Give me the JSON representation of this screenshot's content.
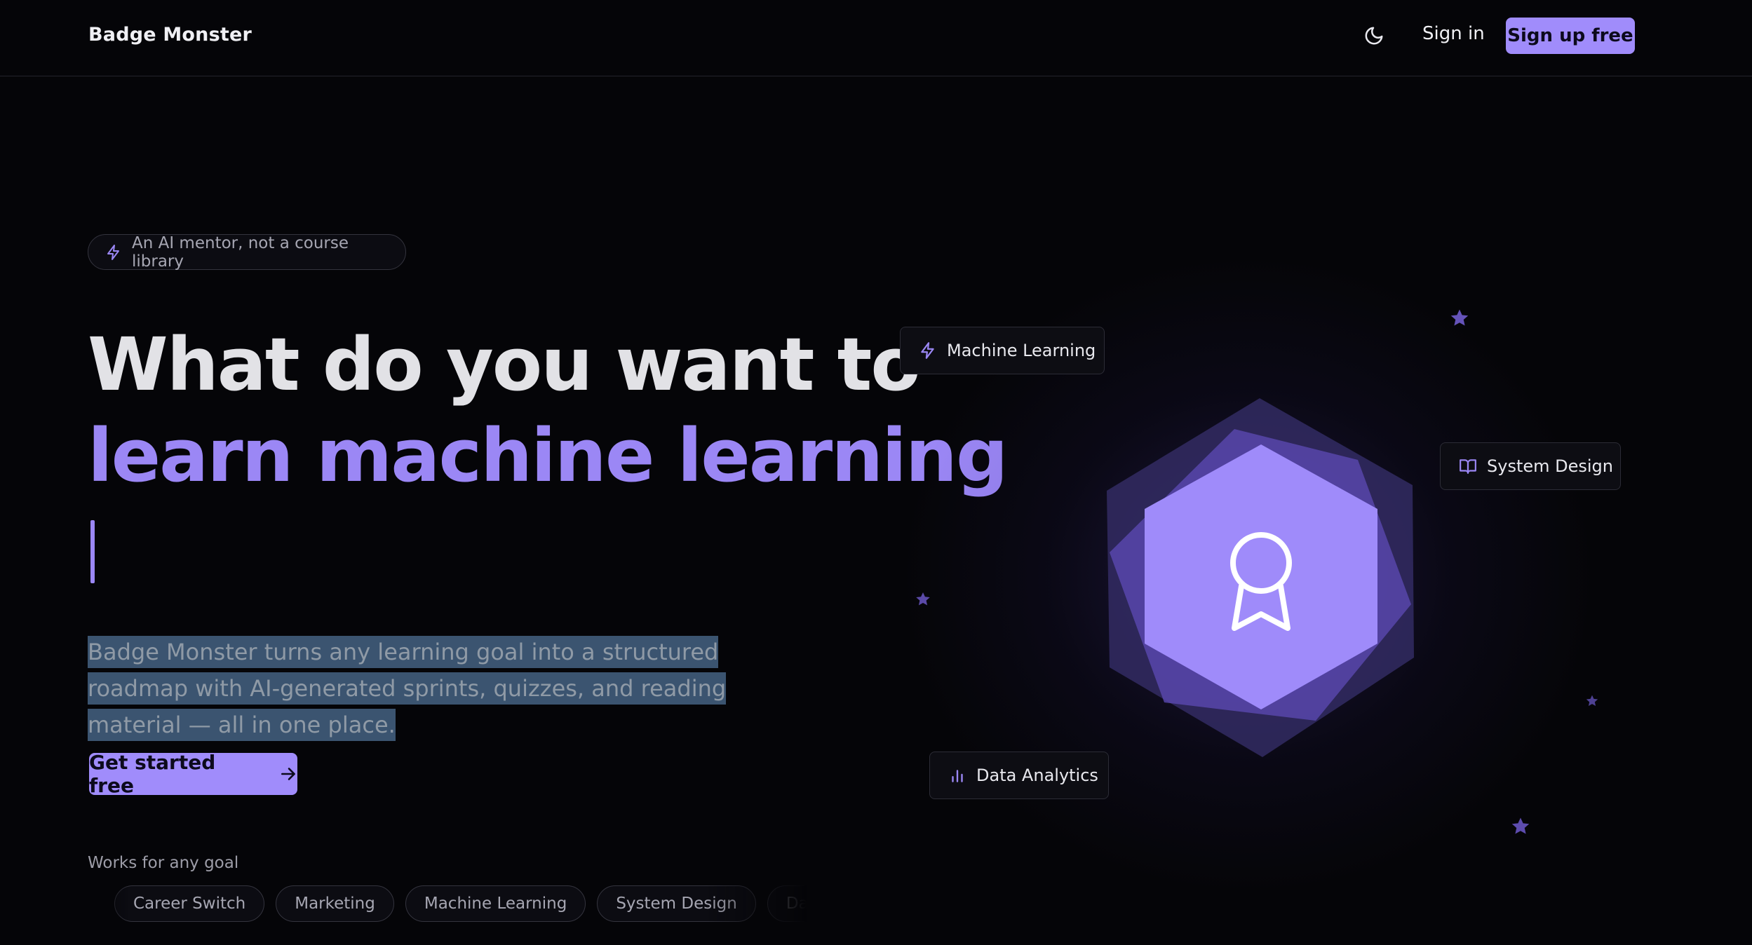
{
  "header": {
    "brand": "Badge Monster",
    "theme_icon": "moon-icon",
    "signin_label": "Sign in",
    "signup_label": "Sign up free"
  },
  "hero": {
    "pill_text": "An AI mentor, not a course library",
    "pill_icon": "lightning-icon",
    "headline_line1": "What do you want to",
    "headline_line2": "learn machine learning",
    "description": "Badge Monster turns any learning goal into a structured roadmap with AI-generated sprints, quizzes, and reading material — all in one place.",
    "cta_label": "Get started free",
    "cta_icon": "arrow-right-icon",
    "works_label": "Works for any goal",
    "chips": [
      "Career Switch",
      "Marketing",
      "Machine Learning",
      "System Design",
      "Data Analytics"
    ]
  },
  "illustration": {
    "center_icon": "award-ribbon-icon",
    "tags": [
      {
        "label": "Machine Learning",
        "icon": "lightning-icon"
      },
      {
        "label": "System Design",
        "icon": "book-open-icon"
      },
      {
        "label": "Data Analytics",
        "icon": "bar-chart-icon"
      }
    ]
  },
  "colors": {
    "accent": "#9b87f5",
    "button": "#a08cfb",
    "background": "#050508",
    "selection": "#3b5470"
  }
}
